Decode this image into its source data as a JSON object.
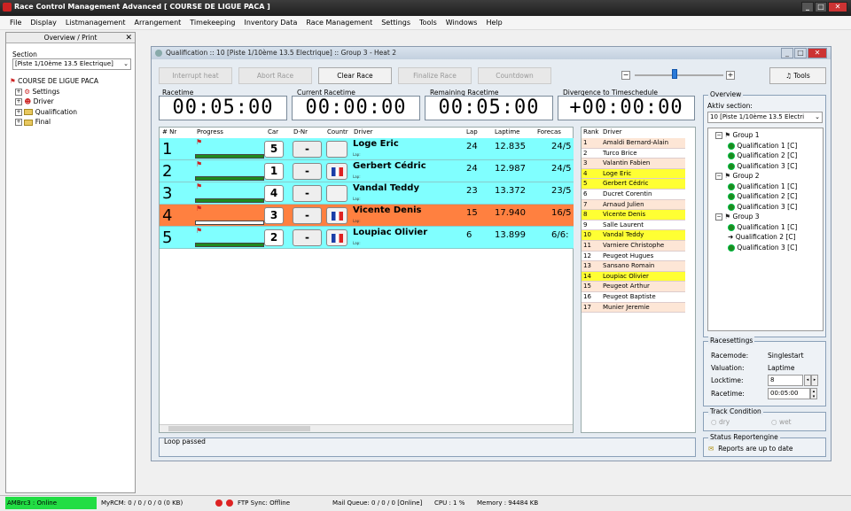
{
  "window": {
    "title": "Race Control Management Advanced  [ COURSE DE LIGUE PACA ]"
  },
  "menu": [
    "File",
    "Display",
    "Listmanagement",
    "Arrangement",
    "Timekeeping",
    "Inventory Data",
    "Race Management",
    "Settings",
    "Tools",
    "Windows",
    "Help"
  ],
  "left_panel": {
    "title": "Overview / Print",
    "section_label": "Section",
    "section_value": "[Piste 1/10ème 13.5 Electrique]",
    "tree_root": "COURSE DE LIGUE PACA",
    "tree_items": [
      "Settings",
      "Driver",
      "Qualification",
      "Final"
    ]
  },
  "race_window": {
    "title": "Qualification :: 10  [Piste 1/10ème 13.5 Electrique] :: Group 3 - Heat 2",
    "buttons": {
      "interrupt": "Interrupt heat",
      "abort": "Abort Race",
      "clear": "Clear Race",
      "finalize": "Finalize Race",
      "countdown": "Countdown",
      "tools": "Tools"
    },
    "timers": {
      "racetime_label": "Racetime",
      "racetime": "00:05:00",
      "current_label": "Current Racetime",
      "current": "00:00:00",
      "remaining_label": "Remaining Racetime",
      "remaining": "00:05:00",
      "divergence_label": "Divergence to Timeschedule",
      "divergence": "+00:00:00"
    },
    "grid_headers": {
      "nr": "# Nr",
      "progress": "Progress",
      "car": "Car",
      "dnr": "D-Nr",
      "country": "Countr",
      "driver": "Driver",
      "lap": "Lap",
      "laptime": "Laptime",
      "forecast": "Forecas"
    },
    "lap_sublabel": "Lap:",
    "rows": [
      {
        "pos": "1",
        "car": "5",
        "dnr": "-",
        "flag": false,
        "driver": "Loge Eric",
        "lap": "24",
        "laptime": "12.835",
        "forecast": "24/5",
        "color": "#80ffff",
        "progress": 1.0
      },
      {
        "pos": "2",
        "car": "1",
        "dnr": "-",
        "flag": true,
        "driver": "Gerbert Cédric",
        "lap": "24",
        "laptime": "12.987",
        "forecast": "24/5",
        "color": "#80ffff",
        "progress": 1.0
      },
      {
        "pos": "3",
        "car": "4",
        "dnr": "-",
        "flag": false,
        "driver": "Vandal Teddy",
        "lap": "23",
        "laptime": "13.372",
        "forecast": "23/5",
        "color": "#80ffff",
        "progress": 1.0
      },
      {
        "pos": "4",
        "car": "3",
        "dnr": "-",
        "flag": true,
        "driver": "Vicente Denis",
        "lap": "15",
        "laptime": "17.940",
        "forecast": "16/5",
        "color": "#ff8040",
        "progress": 0.0
      },
      {
        "pos": "5",
        "car": "2",
        "dnr": "-",
        "flag": true,
        "driver": "Loupiac Olivier",
        "lap": "6",
        "laptime": "13.899",
        "forecast": "6/6:",
        "color": "#80ffff",
        "progress": 1.0
      }
    ],
    "rank_headers": {
      "rank": "Rank",
      "driver": "Driver"
    },
    "ranking": [
      {
        "n": "1",
        "d": "Amaldi Bernard-Alain",
        "c": "#fde6d6"
      },
      {
        "n": "2",
        "d": "Turco Brice",
        "c": "#ffffff"
      },
      {
        "n": "3",
        "d": "Valantin Fabien",
        "c": "#fde6d6"
      },
      {
        "n": "4",
        "d": "Loge Eric",
        "c": "#ffff33"
      },
      {
        "n": "5",
        "d": "Gerbert Cédric",
        "c": "#ffff33"
      },
      {
        "n": "6",
        "d": "Ducret Corentin",
        "c": "#ffffff"
      },
      {
        "n": "7",
        "d": "Arnaud Julien",
        "c": "#fde6d6"
      },
      {
        "n": "8",
        "d": "Vicente Denis",
        "c": "#ffff33"
      },
      {
        "n": "9",
        "d": "Salle Laurent",
        "c": "#ffffff"
      },
      {
        "n": "10",
        "d": "Vandal Teddy",
        "c": "#ffff33"
      },
      {
        "n": "11",
        "d": "Varniere Christophe",
        "c": "#fde6d6"
      },
      {
        "n": "12",
        "d": "Peugeot Hugues",
        "c": "#ffffff"
      },
      {
        "n": "13",
        "d": "Sansano Romain",
        "c": "#fde6d6"
      },
      {
        "n": "14",
        "d": "Loupiac Olivier",
        "c": "#ffff33"
      },
      {
        "n": "15",
        "d": "Peugeot Arthur",
        "c": "#fde6d6"
      },
      {
        "n": "16",
        "d": "Peugeot Baptiste",
        "c": "#ffffff"
      },
      {
        "n": "17",
        "d": "Munier Jeremie",
        "c": "#fde6d6"
      }
    ],
    "loop_label": "Loop passed",
    "slider_level": 0.45,
    "overview": {
      "title": "Overview",
      "aktiv_label": "Aktiv section:",
      "aktiv_value": "10  [Piste 1/10ème 13.5 Electri",
      "groups": [
        {
          "name": "Group 1",
          "quals": [
            "Qualification 1  [C]",
            "Qualification 2  [C]",
            "Qualification 3  [C]"
          ]
        },
        {
          "name": "Group 2",
          "quals": [
            "Qualification 1  [C]",
            "Qualification 2  [C]",
            "Qualification 3  [C]"
          ]
        },
        {
          "name": "Group 3",
          "quals": [
            "Qualification 1  [C]",
            "Qualification 2  [C]",
            "Qualification 3  [C]"
          ]
        }
      ]
    },
    "racesettings": {
      "title": "Racesettings",
      "racemode_label": "Racemode:",
      "racemode": "Singlestart",
      "valuation_label": "Valuation:",
      "valuation": "Laptime",
      "locktime_label": "Locktime:",
      "locktime": "8",
      "racetime_label": "Racetime:",
      "racetime": "00:05:00"
    },
    "track": {
      "title": "Track Condition",
      "dry": "dry",
      "wet": "wet"
    },
    "report": {
      "title": "Status Reportengine",
      "text": "Reports are up to date"
    }
  },
  "statusbar": {
    "ambrc": "AMBrc3 : Online",
    "myrcm": "MyRCM: 0 / 0 / 0 / 0 (0 KB)",
    "ftp": "FTP Sync: Offline",
    "mail": "Mail Queue: 0 / 0 / 0 [Online]",
    "cpu": "CPU : 1 %",
    "memory": "Memory : 94484 KB"
  }
}
